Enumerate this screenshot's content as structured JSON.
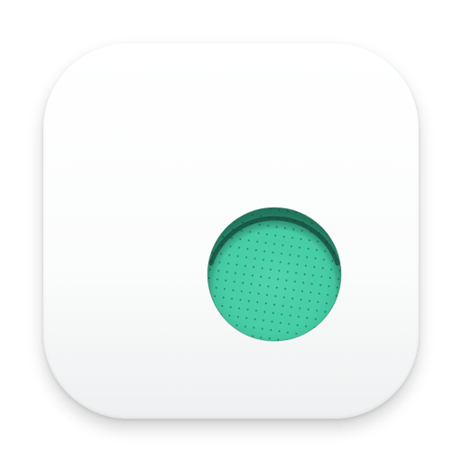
{
  "icon": {
    "name": "app-icon",
    "background_color": "#ffffff",
    "accent_color": "#46cda5",
    "accent_dark": "#2f9e7e",
    "dot_color": "#1f5e4c"
  }
}
